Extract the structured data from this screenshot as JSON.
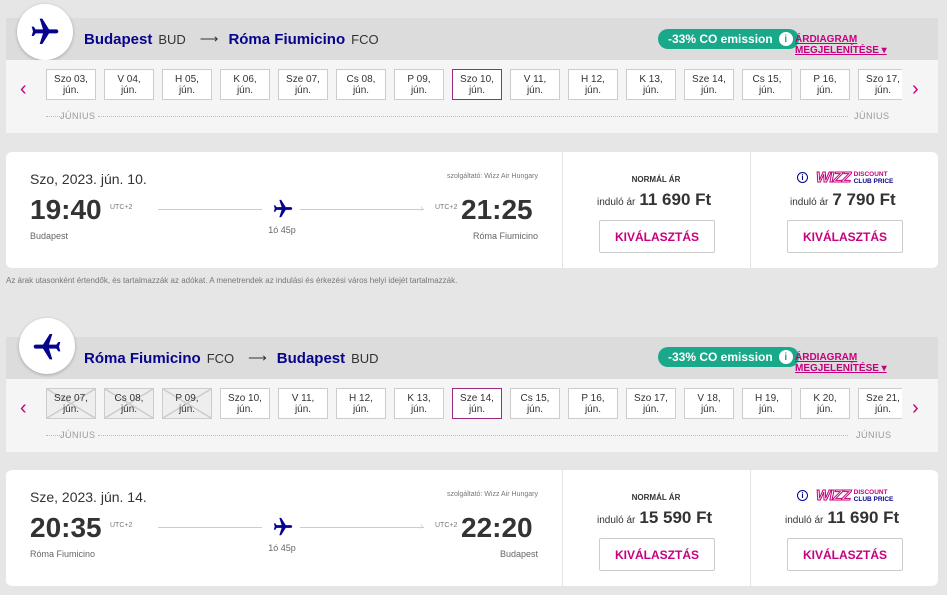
{
  "outbound": {
    "origin_city": "Budapest",
    "origin_code": "BUD",
    "dest_city": "Róma Fiumicino",
    "dest_code": "FCO",
    "co2": "-33% CO emission",
    "chart_link": "ÁRDIAGRAM MEGJELENÍTÉSE",
    "month_label": "JÚNIUS",
    "dates": [
      {
        "d": "Szo 03,",
        "m": "jún.",
        "state": "normal"
      },
      {
        "d": "V 04,",
        "m": "jún.",
        "state": "normal"
      },
      {
        "d": "H 05,",
        "m": "jún.",
        "state": "normal"
      },
      {
        "d": "K 06,",
        "m": "jún.",
        "state": "normal"
      },
      {
        "d": "Sze 07,",
        "m": "jún.",
        "state": "normal"
      },
      {
        "d": "Cs 08,",
        "m": "jún.",
        "state": "normal"
      },
      {
        "d": "P 09,",
        "m": "jún.",
        "state": "normal"
      },
      {
        "d": "Szo 10,",
        "m": "jún.",
        "state": "selected"
      },
      {
        "d": "V 11,",
        "m": "jún.",
        "state": "normal"
      },
      {
        "d": "H 12,",
        "m": "jún.",
        "state": "normal"
      },
      {
        "d": "K 13,",
        "m": "jún.",
        "state": "normal"
      },
      {
        "d": "Sze 14,",
        "m": "jún.",
        "state": "normal"
      },
      {
        "d": "Cs 15,",
        "m": "jún.",
        "state": "normal"
      },
      {
        "d": "P 16,",
        "m": "jún.",
        "state": "normal"
      },
      {
        "d": "Szo 17,",
        "m": "jún.",
        "state": "normal"
      }
    ],
    "flight": {
      "date": "Szo, 2023. jún. 10.",
      "provider": "szolgáltató: Wizz Air Hungary",
      "dep_time": "19:40",
      "dep_utc": "UTC+2",
      "dep_city": "Budapest",
      "arr_time": "21:25",
      "arr_utc": "UTC+2",
      "arr_city": "Róma Fiumicino",
      "duration": "1ó 45p",
      "normal_label": "NORMÁL ÁR",
      "from_label": "induló ár",
      "normal_price": "11 690 Ft",
      "wdc_price": "7 790 Ft",
      "select_label": "KIVÁLASZTÁS"
    }
  },
  "return": {
    "origin_city": "Róma Fiumicino",
    "origin_code": "FCO",
    "dest_city": "Budapest",
    "dest_code": "BUD",
    "co2": "-33% CO emission",
    "chart_link": "ÁRDIAGRAM MEGJELENÍTÉSE",
    "month_label": "JÚNIUS",
    "dates": [
      {
        "d": "Sze 07,",
        "m": "jún.",
        "state": "disabled"
      },
      {
        "d": "Cs 08,",
        "m": "jún.",
        "state": "disabled"
      },
      {
        "d": "P 09,",
        "m": "jún.",
        "state": "disabled"
      },
      {
        "d": "Szo 10,",
        "m": "jún.",
        "state": "normal"
      },
      {
        "d": "V 11,",
        "m": "jún.",
        "state": "normal"
      },
      {
        "d": "H 12,",
        "m": "jún.",
        "state": "normal"
      },
      {
        "d": "K 13,",
        "m": "jún.",
        "state": "normal"
      },
      {
        "d": "Sze 14,",
        "m": "jún.",
        "state": "selected"
      },
      {
        "d": "Cs 15,",
        "m": "jún.",
        "state": "normal"
      },
      {
        "d": "P 16,",
        "m": "jún.",
        "state": "normal"
      },
      {
        "d": "Szo 17,",
        "m": "jún.",
        "state": "normal"
      },
      {
        "d": "V 18,",
        "m": "jún.",
        "state": "normal"
      },
      {
        "d": "H 19,",
        "m": "jún.",
        "state": "normal"
      },
      {
        "d": "K 20,",
        "m": "jún.",
        "state": "normal"
      },
      {
        "d": "Sze 21,",
        "m": "jún.",
        "state": "normal"
      }
    ],
    "flight": {
      "date": "Sze, 2023. jún. 14.",
      "provider": "szolgáltató: Wizz Air Hungary",
      "dep_time": "20:35",
      "dep_utc": "UTC+2",
      "dep_city": "Róma Fiumicino",
      "arr_time": "22:20",
      "arr_utc": "UTC+2",
      "arr_city": "Budapest",
      "duration": "1ó 45p",
      "normal_label": "NORMÁL ÁR",
      "from_label": "induló ár",
      "normal_price": "15 590 Ft",
      "wdc_price": "11 690 Ft",
      "select_label": "KIVÁLASZTÁS"
    }
  },
  "wdc": {
    "brand": "WIZZ",
    "line1": "DISCOUNT",
    "line2": "CLUB PRICE"
  },
  "note": "Az árak utasonként értendők, és tartalmazzák az adókat. A menetrendek az indulási és érkezési város helyi idejét tartalmazzák.",
  "colors": {
    "navy": "#06038d",
    "magenta": "#c6007e",
    "green": "#1aa88a"
  },
  "icons": {
    "plane": "airplane-icon",
    "prev": "chevron-left-icon",
    "next": "chevron-right-icon",
    "info": "info-icon"
  }
}
